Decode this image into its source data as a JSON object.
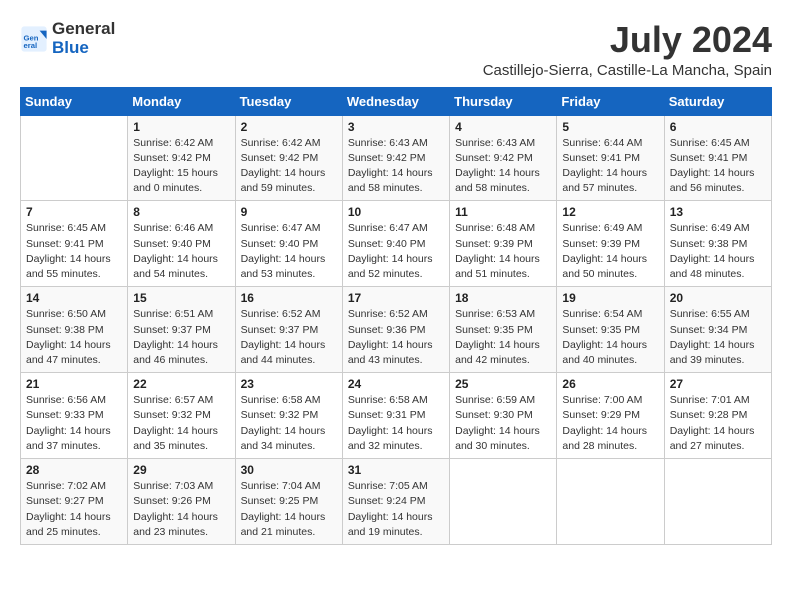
{
  "header": {
    "logo_line1": "General",
    "logo_line2": "Blue",
    "month_year": "July 2024",
    "location": "Castillejo-Sierra, Castille-La Mancha, Spain"
  },
  "weekdays": [
    "Sunday",
    "Monday",
    "Tuesday",
    "Wednesday",
    "Thursday",
    "Friday",
    "Saturday"
  ],
  "weeks": [
    [
      {
        "day": "",
        "info": ""
      },
      {
        "day": "1",
        "info": "Sunrise: 6:42 AM\nSunset: 9:42 PM\nDaylight: 15 hours\nand 0 minutes."
      },
      {
        "day": "2",
        "info": "Sunrise: 6:42 AM\nSunset: 9:42 PM\nDaylight: 14 hours\nand 59 minutes."
      },
      {
        "day": "3",
        "info": "Sunrise: 6:43 AM\nSunset: 9:42 PM\nDaylight: 14 hours\nand 58 minutes."
      },
      {
        "day": "4",
        "info": "Sunrise: 6:43 AM\nSunset: 9:42 PM\nDaylight: 14 hours\nand 58 minutes."
      },
      {
        "day": "5",
        "info": "Sunrise: 6:44 AM\nSunset: 9:41 PM\nDaylight: 14 hours\nand 57 minutes."
      },
      {
        "day": "6",
        "info": "Sunrise: 6:45 AM\nSunset: 9:41 PM\nDaylight: 14 hours\nand 56 minutes."
      }
    ],
    [
      {
        "day": "7",
        "info": "Sunrise: 6:45 AM\nSunset: 9:41 PM\nDaylight: 14 hours\nand 55 minutes."
      },
      {
        "day": "8",
        "info": "Sunrise: 6:46 AM\nSunset: 9:40 PM\nDaylight: 14 hours\nand 54 minutes."
      },
      {
        "day": "9",
        "info": "Sunrise: 6:47 AM\nSunset: 9:40 PM\nDaylight: 14 hours\nand 53 minutes."
      },
      {
        "day": "10",
        "info": "Sunrise: 6:47 AM\nSunset: 9:40 PM\nDaylight: 14 hours\nand 52 minutes."
      },
      {
        "day": "11",
        "info": "Sunrise: 6:48 AM\nSunset: 9:39 PM\nDaylight: 14 hours\nand 51 minutes."
      },
      {
        "day": "12",
        "info": "Sunrise: 6:49 AM\nSunset: 9:39 PM\nDaylight: 14 hours\nand 50 minutes."
      },
      {
        "day": "13",
        "info": "Sunrise: 6:49 AM\nSunset: 9:38 PM\nDaylight: 14 hours\nand 48 minutes."
      }
    ],
    [
      {
        "day": "14",
        "info": "Sunrise: 6:50 AM\nSunset: 9:38 PM\nDaylight: 14 hours\nand 47 minutes."
      },
      {
        "day": "15",
        "info": "Sunrise: 6:51 AM\nSunset: 9:37 PM\nDaylight: 14 hours\nand 46 minutes."
      },
      {
        "day": "16",
        "info": "Sunrise: 6:52 AM\nSunset: 9:37 PM\nDaylight: 14 hours\nand 44 minutes."
      },
      {
        "day": "17",
        "info": "Sunrise: 6:52 AM\nSunset: 9:36 PM\nDaylight: 14 hours\nand 43 minutes."
      },
      {
        "day": "18",
        "info": "Sunrise: 6:53 AM\nSunset: 9:35 PM\nDaylight: 14 hours\nand 42 minutes."
      },
      {
        "day": "19",
        "info": "Sunrise: 6:54 AM\nSunset: 9:35 PM\nDaylight: 14 hours\nand 40 minutes."
      },
      {
        "day": "20",
        "info": "Sunrise: 6:55 AM\nSunset: 9:34 PM\nDaylight: 14 hours\nand 39 minutes."
      }
    ],
    [
      {
        "day": "21",
        "info": "Sunrise: 6:56 AM\nSunset: 9:33 PM\nDaylight: 14 hours\nand 37 minutes."
      },
      {
        "day": "22",
        "info": "Sunrise: 6:57 AM\nSunset: 9:32 PM\nDaylight: 14 hours\nand 35 minutes."
      },
      {
        "day": "23",
        "info": "Sunrise: 6:58 AM\nSunset: 9:32 PM\nDaylight: 14 hours\nand 34 minutes."
      },
      {
        "day": "24",
        "info": "Sunrise: 6:58 AM\nSunset: 9:31 PM\nDaylight: 14 hours\nand 32 minutes."
      },
      {
        "day": "25",
        "info": "Sunrise: 6:59 AM\nSunset: 9:30 PM\nDaylight: 14 hours\nand 30 minutes."
      },
      {
        "day": "26",
        "info": "Sunrise: 7:00 AM\nSunset: 9:29 PM\nDaylight: 14 hours\nand 28 minutes."
      },
      {
        "day": "27",
        "info": "Sunrise: 7:01 AM\nSunset: 9:28 PM\nDaylight: 14 hours\nand 27 minutes."
      }
    ],
    [
      {
        "day": "28",
        "info": "Sunrise: 7:02 AM\nSunset: 9:27 PM\nDaylight: 14 hours\nand 25 minutes."
      },
      {
        "day": "29",
        "info": "Sunrise: 7:03 AM\nSunset: 9:26 PM\nDaylight: 14 hours\nand 23 minutes."
      },
      {
        "day": "30",
        "info": "Sunrise: 7:04 AM\nSunset: 9:25 PM\nDaylight: 14 hours\nand 21 minutes."
      },
      {
        "day": "31",
        "info": "Sunrise: 7:05 AM\nSunset: 9:24 PM\nDaylight: 14 hours\nand 19 minutes."
      },
      {
        "day": "",
        "info": ""
      },
      {
        "day": "",
        "info": ""
      },
      {
        "day": "",
        "info": ""
      }
    ]
  ]
}
